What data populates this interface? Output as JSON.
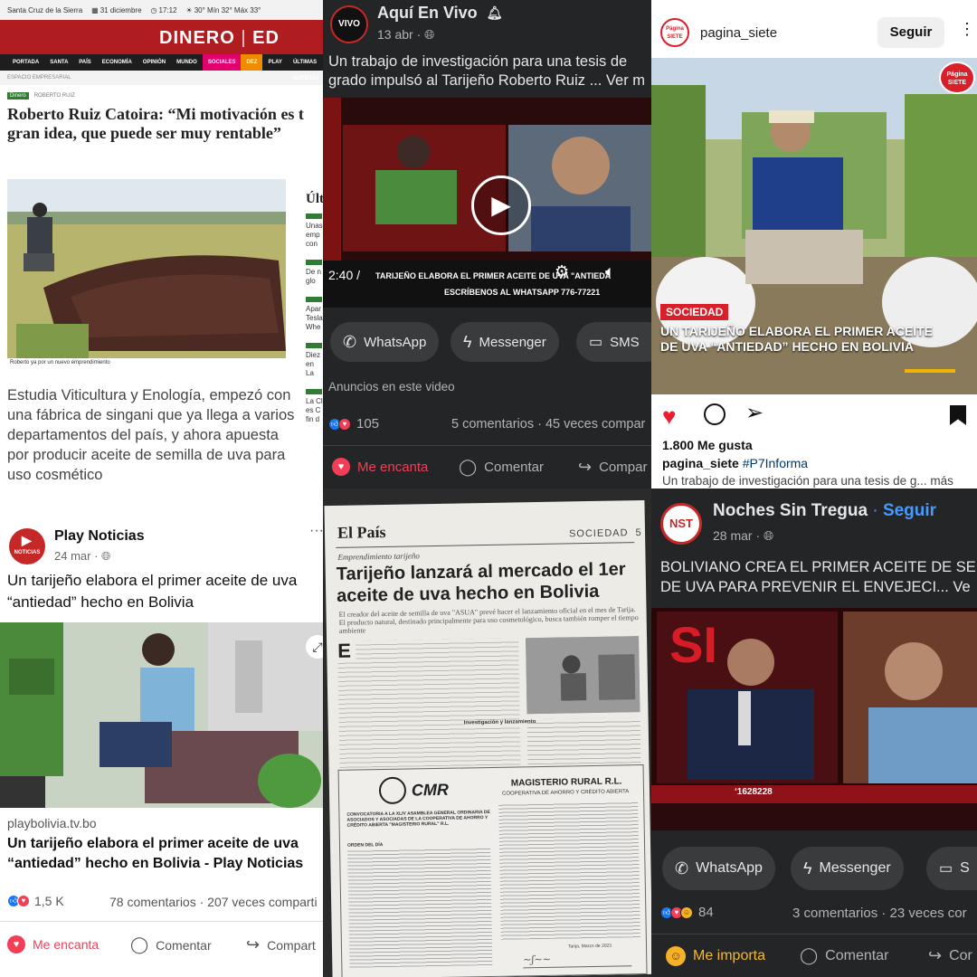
{
  "dinero": {
    "status_city": "Santa Cruz de la Sierra",
    "status_date": "31 diciembre",
    "status_time": "17:12",
    "status_weather": "30°  Mín 32° Máx 33°",
    "brand_left": "DINERO",
    "brand_right": "ED",
    "nav": [
      "PORTADA",
      "SANTA CRUZ",
      "PAÍS",
      "ECONOMÍA",
      "OPINIÓN",
      "MUNDO",
      "SOCIALES",
      "DEZ",
      "PLAY",
      "ÚLTIMAS NOTICIAS"
    ],
    "section": "ESPACIO EMPRESARIAL",
    "tag": "Dinero",
    "author": "ROBERTO RUIZ",
    "headline": "Roberto Ruiz Catoira: “Mi motivación es t gran idea, que puede ser muy rentable”",
    "photo_caption": "Roberto ya por un nuevo emprendimiento",
    "sidebar_title": "Últ",
    "sidebar_items": [
      "Unas emp con",
      "De n glo",
      "Apar Tesla Whe",
      "Diez en La",
      "La Cl es C fin d"
    ],
    "lead": "Estudia Viticultura y Enología, empezó con una fábrica de singani que ya llega a varios departamentos del país, y ahora apuesta por producir aceite de semilla de uva para uso cosmético"
  },
  "play": {
    "page_name": "Play Noticias",
    "avatar_text": "NOTICIAS",
    "date": "24 mar ·",
    "more": "···",
    "post_text": "Un tarijeño elabora el primer aceite de uva “antiedad” hecho en Bolivia",
    "link_domain": "playbolivia.tv.bo",
    "link_title": "Un tarijeño elabora el primer aceite de uva “antiedad” hecho en Bolivia - Play Noticias",
    "reactions_count": "1,5 K",
    "comments": "78 comentarios · 207 veces comparti",
    "actions": [
      "Me encanta",
      "Comentar",
      "Compart"
    ]
  },
  "vivo": {
    "page_name": "Aquí En Vivo",
    "avatar_text": "VIVO",
    "date": "13 abr ·",
    "post_text": "Un trabajo de investigación para una tesis de grado impulsó al Tarijeño Roberto Ruiz ... Ver m",
    "video_time": "2:40 /",
    "video_banner": "TARIJEÑO ELABORA EL PRIMER ACEITE DE UVA \"ANTIEDAD\" EN BOLIVIA",
    "video_whatsapp": "ESCRÍBENOS AL WHATSAPP 776-77221",
    "share_buttons": [
      "WhatsApp",
      "Messenger",
      "SMS"
    ],
    "ads_label": "Anuncios en este video",
    "reactions_count": "105",
    "comments": "5 comentarios · 45 veces compar",
    "actions": [
      "Me encanta",
      "Comentar",
      "Compar"
    ]
  },
  "paper": {
    "masthead": "El País",
    "section": "SOCIEDAD",
    "page_no": "5",
    "kicker": "Emprendimiento tarijeño",
    "headline": "Tarijeño lanzará al mercado el 1er aceite de uva hecho en Bolivia",
    "dek": "El creador del aceite de semilla de uva \"ASUA\" prevé hacer el lanzamiento oficial en el mes de Tarija. El producto natural, destinado principalmente para uso cosmetológico, busca también romper el tiempo ambiente",
    "subhead": "Investigación y lanzamiento",
    "ad_logo": "CMR",
    "ad_title": "MAGISTERIO RURAL R.L.",
    "ad_sub": "COOPERATIVA DE AHORRO Y CRÉDITO ABIERTA",
    "ad_heading": "CONVOCATORIA A LA XLIV ASAMBLEA GENERAL ORDINARIA DE ASOCIADOS Y ASOCIADAS DE LA COOPERATIVA DE AHORRO Y CRÉDITO ABIERTA \"MAGISTERIO RURAL\" R.L.",
    "ad_orden": "ORDEN DEL DÍA",
    "ad_footer": "Tarija, Marzo de 2023"
  },
  "siete": {
    "account": "pagina_siete",
    "avatar_text": "Página SIETE",
    "follow_button": "Seguir",
    "badge": "Página SIETE",
    "section": "SOCIEDAD",
    "overlay_title": "UN TARIJEÑO ELABORA EL PRIMER ACEITE DE UVA “ANTIEDAD” HECHO EN BOLIVIA",
    "likes": "1.800 Me gusta",
    "caption_user": "pagina_siete",
    "caption_tag": "#P7Informa",
    "caption_text": "Un trabajo de investigación para una tesis de g... más"
  },
  "nst": {
    "page_name": "Noches Sin Tregua",
    "follow": "Seguir",
    "avatar_text": "NST",
    "date": "28 mar ·",
    "post_text": "BOLIVIANO CREA EL PRIMER ACEITE DE SE DE UVA PARA PREVENIR EL ENVEJECI... Ve",
    "video_ticker": "‘1628228",
    "share_buttons": [
      "WhatsApp",
      "Messenger",
      "S"
    ],
    "reactions_count": "84",
    "comments": "3 comentarios · 23 veces cor",
    "actions": [
      "Me importa",
      "Comentar",
      "Cor"
    ]
  },
  "colors": {
    "fb_blue": "#1877f2",
    "love_red": "#f33e58",
    "dinero_red": "#b01d21",
    "siete_red": "#d9202a"
  }
}
